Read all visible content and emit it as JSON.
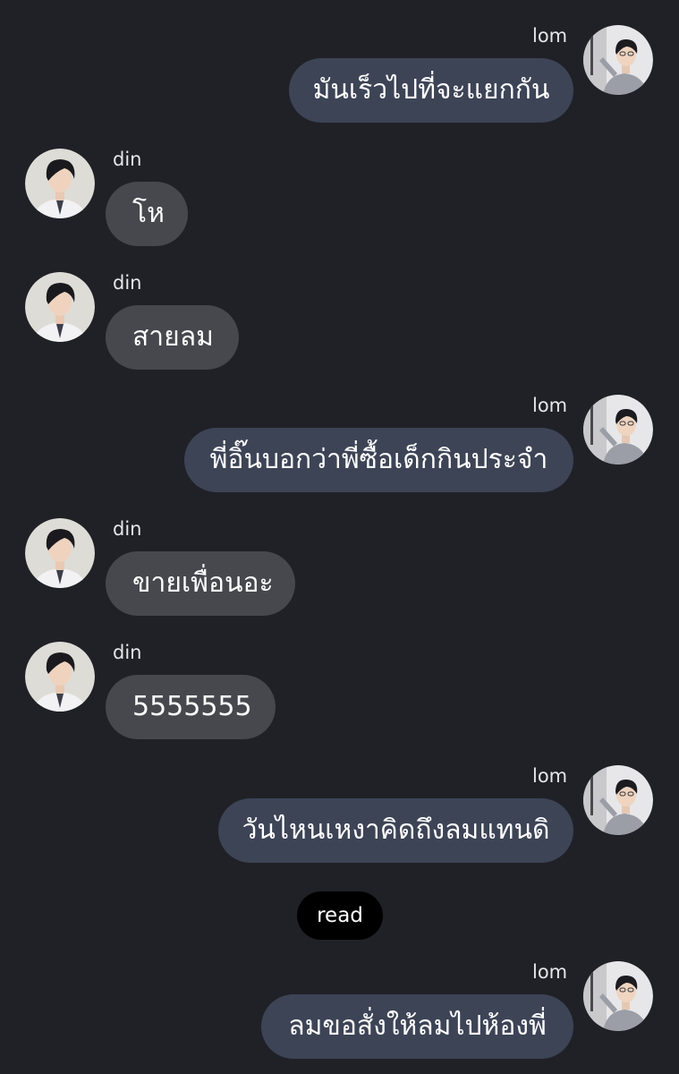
{
  "messages": [
    {
      "sender": "lom",
      "text": "มันเร็วไปที่จะแยกกัน"
    },
    {
      "sender": "din",
      "text": "โห"
    },
    {
      "sender": "din",
      "text": "สายลม"
    },
    {
      "sender": "lom",
      "text": "พี่อิ๊นบอกว่าพี่ซื้อเด็กกินประจำ"
    },
    {
      "sender": "din",
      "text": "ขายเพื่อนอะ"
    },
    {
      "sender": "din",
      "text": "5555555"
    },
    {
      "sender": "lom",
      "text": "วันไหนเหงาคิดถึงลมแทนดิ"
    },
    {
      "sender": "lom",
      "text": "ลมขอสั่งให้ลมไปห้องพี่"
    }
  ],
  "read_receipt": "read",
  "colors": {
    "background": "#202127",
    "incoming_bubble": "#47484e",
    "outgoing_bubble": "#3d4456",
    "read_badge": "#000000"
  },
  "icons": {
    "din_avatar": "profile-photo",
    "lom_avatar": "profile-photo"
  }
}
